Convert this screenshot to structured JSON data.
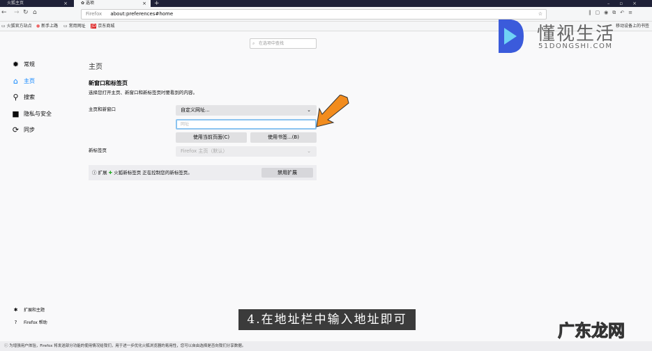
{
  "tabs": [
    {
      "label": "火狐主页",
      "active": false
    },
    {
      "label": "选项",
      "active": true
    }
  ],
  "navbar": {
    "identity": "Firefox",
    "url": "about:preferences#home"
  },
  "bookmarks": [
    "火狐官方站点",
    "新手上路",
    "常用网址",
    "京东商城"
  ],
  "bookmark_overflow": "移动设备上的书签",
  "search": {
    "placeholder": "在选项中查找"
  },
  "sidebar": {
    "items": [
      {
        "label": "常规",
        "icon": "gear-icon"
      },
      {
        "label": "主页",
        "icon": "home-icon",
        "active": true
      },
      {
        "label": "搜索",
        "icon": "search-icon"
      },
      {
        "label": "隐私与安全",
        "icon": "lock-icon"
      },
      {
        "label": "同步",
        "icon": "sync-icon"
      }
    ],
    "bottom": [
      {
        "label": "扩展和主题"
      },
      {
        "label": "Firefox 帮助"
      }
    ]
  },
  "main": {
    "title": "主页",
    "section_title": "新窗口和标签页",
    "section_desc": "选择您打开主页、新窗口和新标签页时要看到的内容。",
    "home_label": "主页和新窗口",
    "home_select": "自定义网址...",
    "url_input_placeholder": "网址",
    "use_current": "使用当前页面(C)",
    "use_bookmark": "使用书签...(B)",
    "newtab_label": "新标签页",
    "newtab_select": "Firefox 主页（默认）",
    "ext_prefix": "扩展",
    "ext_name": "火狐新标签页",
    "ext_text": "正在控制您的新标签页。",
    "disable_ext": "禁用扩展"
  },
  "caption": "4.在地址栏中输入地址即可",
  "notification": "为增强用户体验，Firefox 将发送部分功能的使用情况给我们，用于进一步优化火狐浏览器的易用性，您可以自由选择是否向我们分享数据。",
  "watermark": {
    "logo_cn": "懂视生活",
    "logo_en": "51DONGSHI.COM",
    "bottom": "广东龙网"
  },
  "colors": {
    "accent": "#0a84ff",
    "caption_bg": "#3b3b3b",
    "arrow": "#f28c1e"
  }
}
